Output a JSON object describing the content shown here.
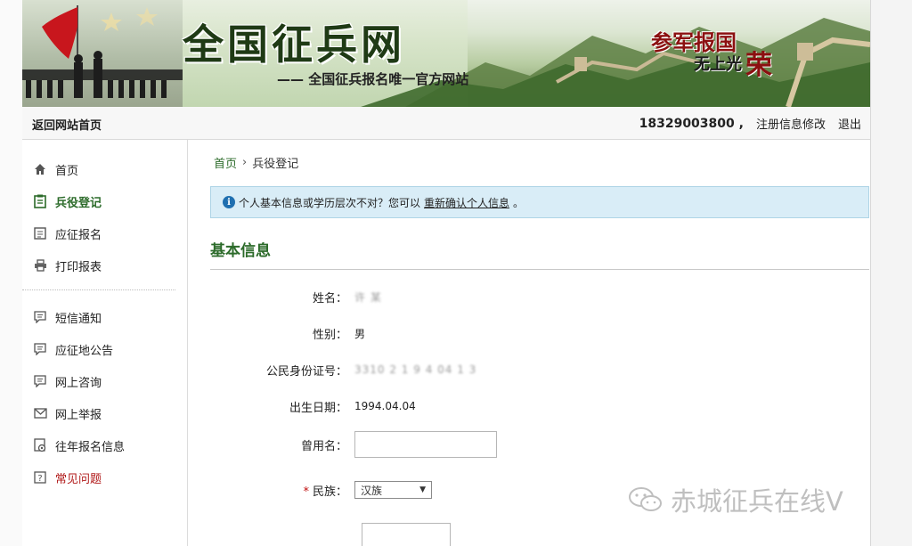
{
  "banner": {
    "title": "全国征兵网",
    "subtitle": "—— 全国征兵报名唯一官方网站",
    "slogan_a": "参军报国",
    "slogan_b": "无上光",
    "slogan_c": "荣"
  },
  "topbar": {
    "home_link": "返回网站首页",
    "phone": "18329003800 ,",
    "edit_link": "注册信息修改",
    "logout_link": "退出"
  },
  "sidebar": {
    "items": [
      {
        "label": "首页",
        "icon": "home-icon"
      },
      {
        "label": "兵役登记",
        "icon": "form-icon"
      },
      {
        "label": "应征报名",
        "icon": "document-icon"
      },
      {
        "label": "打印报表",
        "icon": "printer-icon"
      },
      {
        "label": "短信通知",
        "icon": "message-icon"
      },
      {
        "label": "应征地公告",
        "icon": "message-icon"
      },
      {
        "label": "网上咨询",
        "icon": "message-icon"
      },
      {
        "label": "网上举报",
        "icon": "mail-icon"
      },
      {
        "label": "往年报名信息",
        "icon": "history-icon"
      },
      {
        "label": "常见问题",
        "icon": "question-icon"
      }
    ]
  },
  "breadcrumb": {
    "home": "首页",
    "separator": "›",
    "current": "兵役登记"
  },
  "notice": {
    "text": "个人基本信息或学历层次不对？您可以",
    "link": "重新确认个人信息",
    "end": "。"
  },
  "section": {
    "title": "基本信息"
  },
  "form": {
    "name_label": "姓名：",
    "name_value": "许  某",
    "gender_label": "性别：",
    "gender_value": "男",
    "id_label": "公民身份证号：",
    "id_value": "3310 2  1 9 4 04 1 3",
    "birth_label": "出生日期：",
    "birth_value": "1994.04.04",
    "alias_label": "曾用名：",
    "alias_value": "",
    "ethnic_required": "*",
    "ethnic_label": "民族：",
    "ethnic_value": "汉族"
  },
  "watermark": {
    "text": "赤城征兵在线V"
  },
  "colors": {
    "accent": "#2c6b2a",
    "notice_bg": "#d9edf7",
    "danger": "#b01818"
  }
}
